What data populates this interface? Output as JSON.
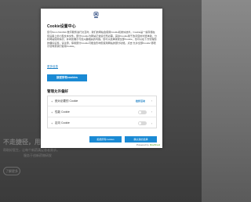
{
  "background": {
    "hero_text": "不走捷径，用最好的方式",
    "sub_text_1": "帮助好医生，让每个新药满足患者需求。",
    "sub_text_2": "服务于创新药物研发",
    "button_label": "了解更多"
  },
  "modal": {
    "logo_icon": "company-logo-icon",
    "title": "Cookie设置中心",
    "body": "您与Novo Nordisk 数字服务进行交互时，我们的网站会使用Cookie和类似技术。Cookie是一些存储在您设备上的小型文本文件。部分Cookie为网站正常运行所必需，其余Cookie用于改善您的浏览体验、分析网站使用情况，并向您展示与您兴趣相关的内容。您可以选择接受全部Cookie，也可以在下方管理您的偏好设置。请注意，停用部分Cookie可能会影响您使用网站的部分功能。点击“允许全部Cookie”即表示您同意我们使用Cookie。",
    "more_info_link": "更多信息",
    "allow_all_label": "接受所有cookies",
    "preferences_title": "管理允许偏好",
    "preferences": [
      {
        "label": "绝对必要的 Cookie",
        "status": "始终活动",
        "type": "always"
      },
      {
        "label": "性能 Cookie",
        "type": "toggle",
        "enabled": false
      },
      {
        "label": "定向 Cookie",
        "type": "toggle",
        "enabled": false
      }
    ],
    "save_label": "拒绝所有cookies",
    "confirm_label": "确认我的选择",
    "powered_by": "Powered by",
    "powered_brand": "OneTrust"
  },
  "colors": {
    "accent": "#1a8ad4",
    "link": "#1a7fc4",
    "brand_green": "#6cae3e"
  }
}
